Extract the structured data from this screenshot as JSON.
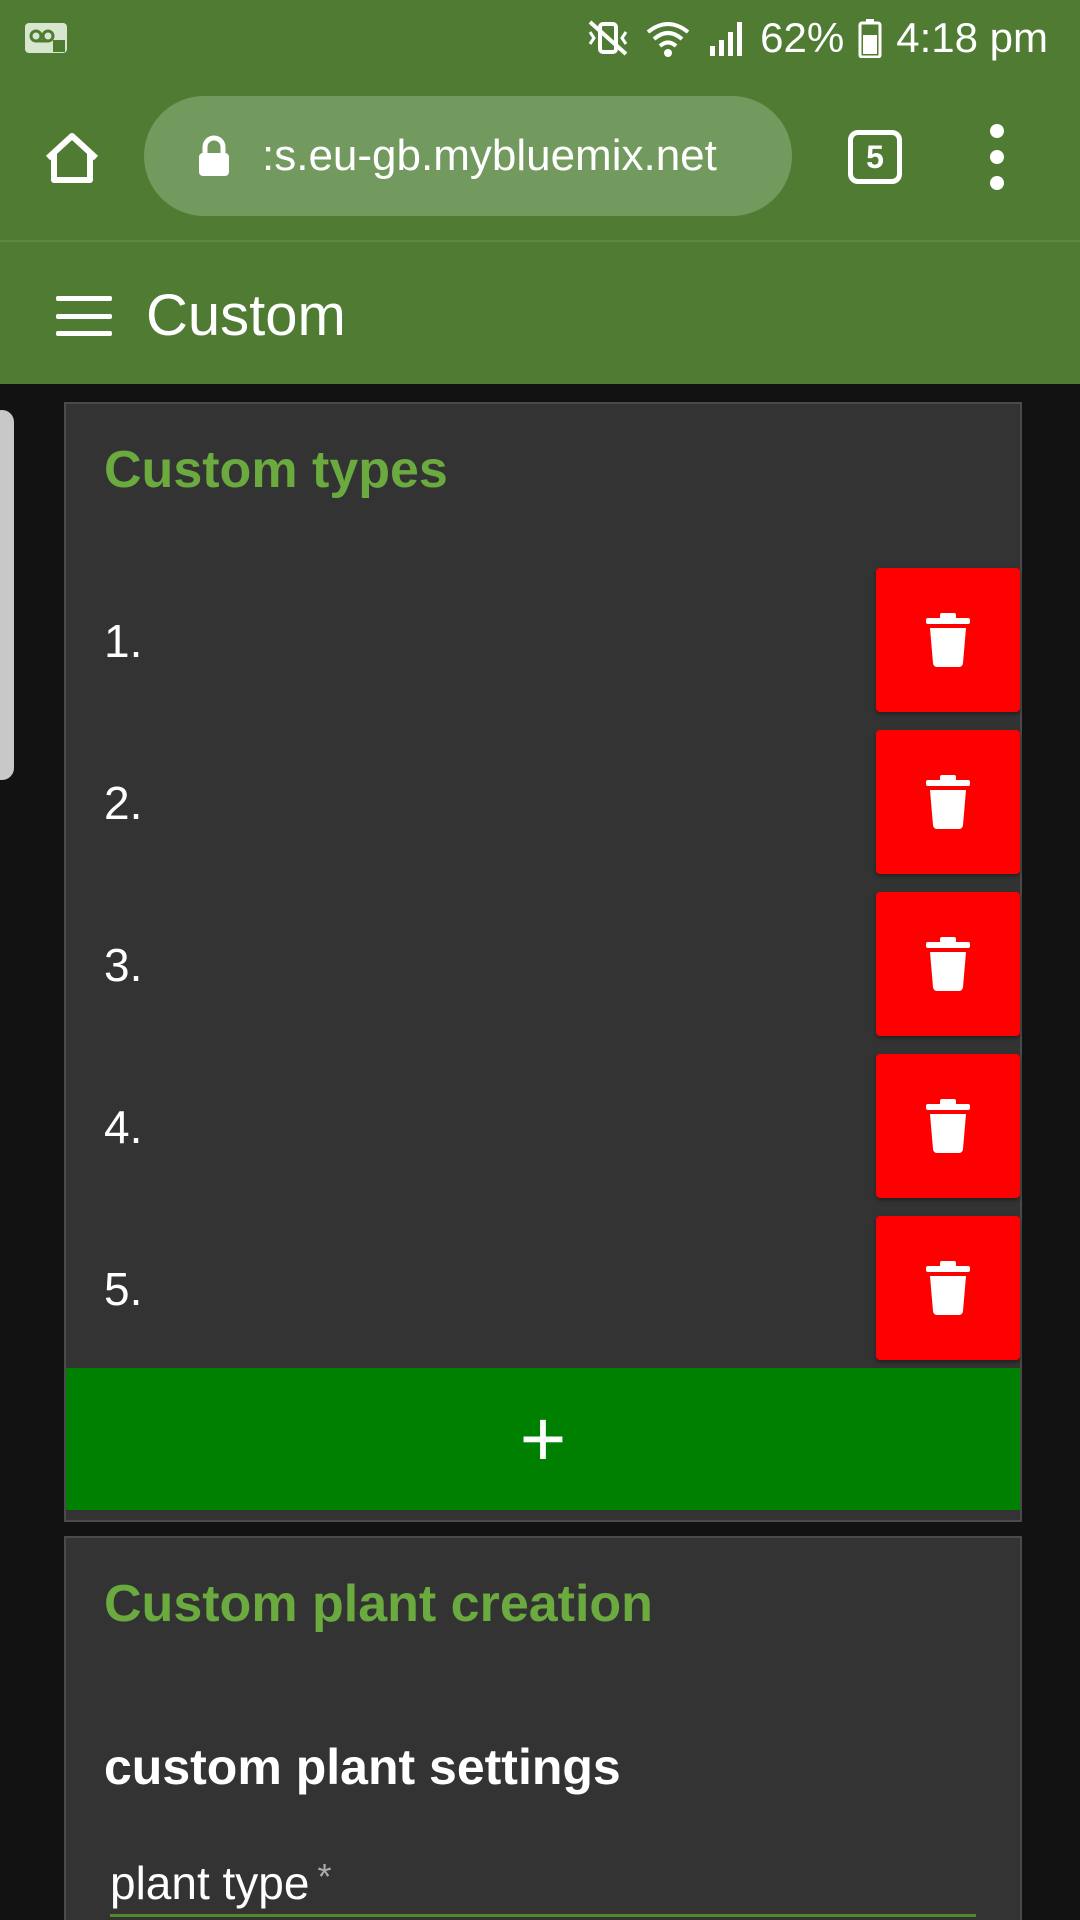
{
  "status_bar": {
    "battery": "62%",
    "time": "4:18 pm",
    "icons": [
      "voicemail-icon",
      "mute-vibrate-icon",
      "wifi-icon",
      "signal-icon",
      "battery-icon"
    ]
  },
  "browser": {
    "url": ":s.eu-gb.mybluemix.net",
    "tab_count": "5",
    "icons": [
      "home-icon",
      "lock-icon",
      "tabs-icon",
      "more-vert-icon"
    ]
  },
  "app_bar": {
    "title": "Custom",
    "icon": "hamburger-menu-icon"
  },
  "custom_types": {
    "title": "Custom types",
    "items": [
      {
        "number": "1.",
        "value": ""
      },
      {
        "number": "2.",
        "value": ""
      },
      {
        "number": "3.",
        "value": ""
      },
      {
        "number": "4.",
        "value": ""
      },
      {
        "number": "5.",
        "value": ""
      }
    ],
    "delete_icon": "trash-icon",
    "add_label": "+"
  },
  "custom_plant_creation": {
    "title": "Custom plant creation",
    "subheading": "custom plant settings",
    "field_label": "plant type",
    "required_marker": "*"
  },
  "colors": {
    "header_green": "#4f7c32",
    "title_green": "#6aaa3f",
    "delete_red": "#ff0000",
    "add_green": "#008000",
    "card_bg": "#333333",
    "page_bg": "#121212"
  }
}
